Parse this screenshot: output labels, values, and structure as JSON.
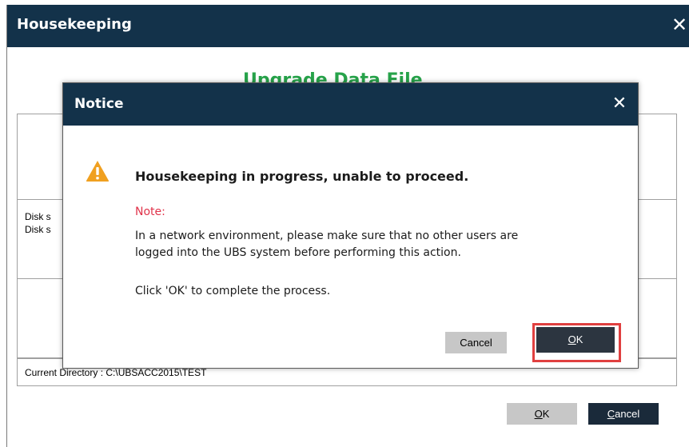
{
  "main_window": {
    "title": "Housekeeping",
    "close_glyph": "✕",
    "heading": "Upgrade Data File",
    "disk_line1": "Disk s",
    "disk_line2": "Disk s",
    "current_directory": "Current Directory : C:\\UBSACC2015\\TEST",
    "ok_key": "O",
    "ok_rest": "K",
    "cancel_key": "C",
    "cancel_rest": "ancel"
  },
  "notice": {
    "title": "Notice",
    "close_glyph": "✕",
    "icon": "warning-icon",
    "message": "Housekeeping in progress, unable to proceed.",
    "note_label": "Note:",
    "note_line1": "In a network environment, please make sure that no other users are",
    "note_line2": "logged into the UBS system before performing this action.",
    "note_line3": "Click 'OK' to complete the process.",
    "cancel_label": "Cancel",
    "ok_key": "O",
    "ok_rest": "K"
  },
  "colors": {
    "titlebar": "#13324a",
    "heading_green": "#27a34a",
    "note_red": "#e0334a",
    "warning_orange": "#f0a020",
    "highlight_red": "#e04040"
  }
}
